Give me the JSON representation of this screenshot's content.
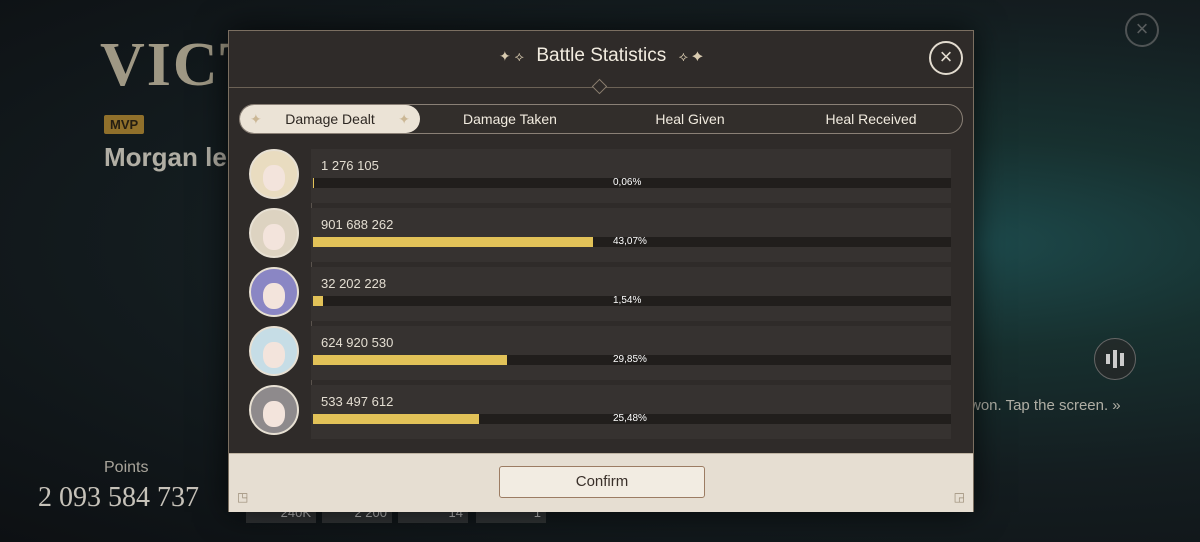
{
  "background": {
    "title": "VICT",
    "mvp_label": "MVP",
    "player_name": "Morgan le",
    "points_label": "Points",
    "points_value": "2 093 584 737",
    "hint": "won. Tap the screen. »",
    "chips": [
      "240K",
      "2 200",
      "14",
      "1"
    ]
  },
  "modal": {
    "title": "Battle Statistics",
    "tabs": [
      "Damage Dealt",
      "Damage Taken",
      "Heal Given",
      "Heal Received"
    ],
    "active_tab": "Damage Dealt",
    "rows": [
      {
        "value": "1 276 105",
        "percent_label": "0,06%",
        "percent": 0.06,
        "hair": "#e9dcc0"
      },
      {
        "value": "901 688 262",
        "percent_label": "43,07%",
        "percent": 43.07,
        "hair": "#ddd3c1"
      },
      {
        "value": "32 202 228",
        "percent_label": "1,54%",
        "percent": 1.54,
        "hair": "#8a86c4"
      },
      {
        "value": "624 920 530",
        "percent_label": "29,85%",
        "percent": 29.85,
        "hair": "#c6dde6"
      },
      {
        "value": "533 497 612",
        "percent_label": "25,48%",
        "percent": 25.48,
        "hair": "#8e8a8c"
      }
    ],
    "confirm_label": "Confirm",
    "bar_color": "#e2c258"
  }
}
